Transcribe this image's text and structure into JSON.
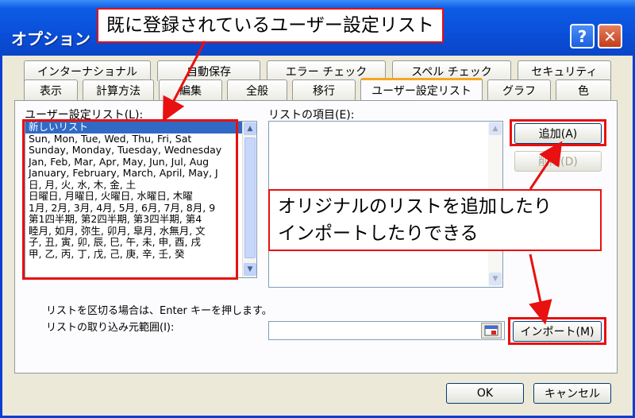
{
  "window": {
    "title": "オプション",
    "help_glyph": "?",
    "close_glyph": "✕"
  },
  "tabs_row1": [
    "インターナショナル",
    "自動保存",
    "エラー チェック",
    "スペル チェック",
    "セキュリティ"
  ],
  "tabs_row2": [
    "表示",
    "計算方法",
    "編集",
    "全般",
    "移行",
    "ユーザー設定リスト",
    "グラフ",
    "色"
  ],
  "active_tab": "ユーザー設定リスト",
  "custom_lists": {
    "label": "ユーザー設定リスト(L):",
    "items": [
      "新しいリスト",
      "Sun, Mon, Tue, Wed, Thu, Fri, Sat",
      "Sunday, Monday, Tuesday, Wednesday",
      "Jan, Feb, Mar, Apr, May, Jun, Jul, Aug",
      "January, February, March, April, May, J",
      "日, 月, 火, 水, 木, 金, 土",
      "日曜日, 月曜日, 火曜日, 水曜日, 木曜",
      "1月, 2月, 3月, 4月, 5月, 6月, 7月, 8月, 9",
      "第1四半期, 第2四半期, 第3四半期, 第4",
      "睦月, 如月, 弥生, 卯月, 皐月, 水無月, 文",
      "子, 丑, 寅, 卯, 辰, 巳, 午, 未, 申, 酉, 戌",
      "甲, 乙, 丙, 丁, 戊, 己, 庚, 辛, 壬, 癸"
    ],
    "selected_index": 0
  },
  "list_entries": {
    "label": "リストの項目(E):",
    "value": ""
  },
  "buttons": {
    "add": "追加(A)",
    "delete": "削除(D)",
    "import": "インポート(M)",
    "ok": "OK",
    "cancel": "キャンセル"
  },
  "hint_text": "リストを区切る場合は、Enter キーを押します。",
  "import_range": {
    "label": "リストの取り込み元範囲(I):",
    "value": ""
  },
  "annotations": {
    "top": "既に登録されているユーザー設定リスト",
    "middle_line1": "オリジナルのリストを追加したり",
    "middle_line2": "インポートしたりできる",
    "color": "#e81010"
  }
}
